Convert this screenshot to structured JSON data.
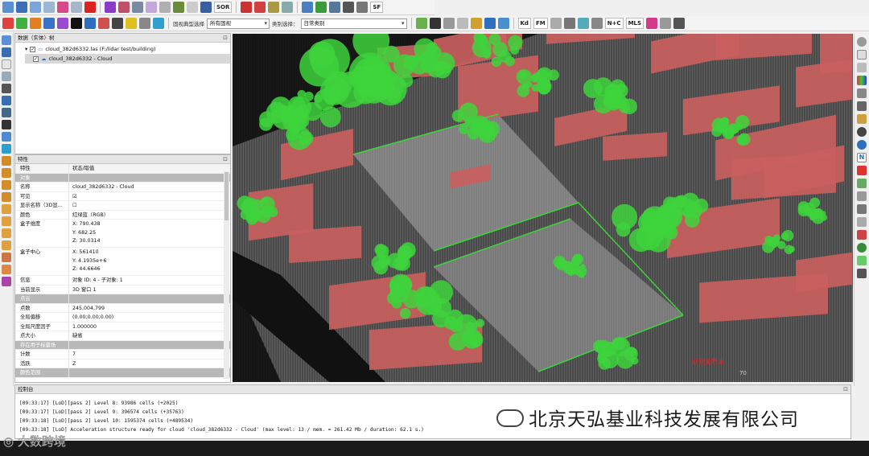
{
  "toolbar": {
    "top_labels": [
      "SOR",
      "SF"
    ],
    "display_label": "固视典型选择",
    "display_value": "所有固视",
    "class_label": "类别选择：",
    "class_value": "日常类别",
    "small_labels": [
      "Kd",
      "FM",
      "N+C",
      "MLS"
    ]
  },
  "db_panel": {
    "title": "数据（实体）树",
    "file_row": "cloud_382d6332.las (F:/lidar test/building)",
    "cloud_row": "cloud_382d6332 - Cloud"
  },
  "props_panel": {
    "title": "特性",
    "header": {
      "key": "特性",
      "value": "状态/取值"
    },
    "rows": [
      {
        "type": "sec",
        "key": "对象",
        "value": ""
      },
      {
        "key": "名称",
        "value": "cloud_382d6332 - Cloud"
      },
      {
        "key": "可见",
        "value": "☑"
      },
      {
        "key": "显示名称（3D显...",
        "value": "☐"
      },
      {
        "key": "颜色",
        "value": "红绿蓝（RGB）"
      },
      {
        "type": "tall",
        "key": "盒子维度",
        "value": "X: 790.438\nY: 682.25\nZ: 30.0314"
      },
      {
        "type": "tall",
        "key": "盒子中心",
        "value": "X: 561410\nY: 4.1935e+6\nZ: 44.6646"
      },
      {
        "key": "信息",
        "value": "对象 ID: 4 - 子对象: 1"
      },
      {
        "key": "当前显示",
        "value": "3D 窗口 1"
      },
      {
        "type": "sec",
        "key": "点云",
        "value": ""
      },
      {
        "key": "点数",
        "value": "245,004,799"
      },
      {
        "key": "全局偏移",
        "value": "(0.00;0.00;0.00)"
      },
      {
        "key": "全局尺度因子",
        "value": "1.000000"
      },
      {
        "key": "点大小",
        "value": "缺省"
      },
      {
        "type": "sec",
        "key": "存在用子标量场",
        "value": ""
      },
      {
        "key": "计数",
        "value": "7"
      },
      {
        "key": "活跃",
        "value": "Z"
      },
      {
        "type": "sec",
        "key": "颜色范围",
        "value": ""
      }
    ]
  },
  "console": {
    "title": "控制台",
    "lines": [
      "[09:33:17] [LoD][pass 2] Level 8: 93986 cells (+2025)",
      "[09:33:17] [LoD][pass 2] Level 9: 396574 cells (+35763)",
      "[09:33:18] [LoD][pass 2] Level 10: 1595374 cells (+489534)",
      "[09:33:18] [LoD] Acceleration structure ready for cloud 'cloud_382d6332 - Cloud' (max level: 13 / mem. = 261.42 Mb / duration: 62.1 s.)"
    ]
  },
  "viewport": {
    "label": "云测量数据",
    "scale_value": "70"
  },
  "watermarks": {
    "company": "北京天弘基业科技发展有限公司",
    "corner": "大数跨境"
  },
  "colors": {
    "building": "#c9605e",
    "vegetation": "#3ed43c",
    "ground": "#9a9a9a",
    "background": "#141414"
  }
}
